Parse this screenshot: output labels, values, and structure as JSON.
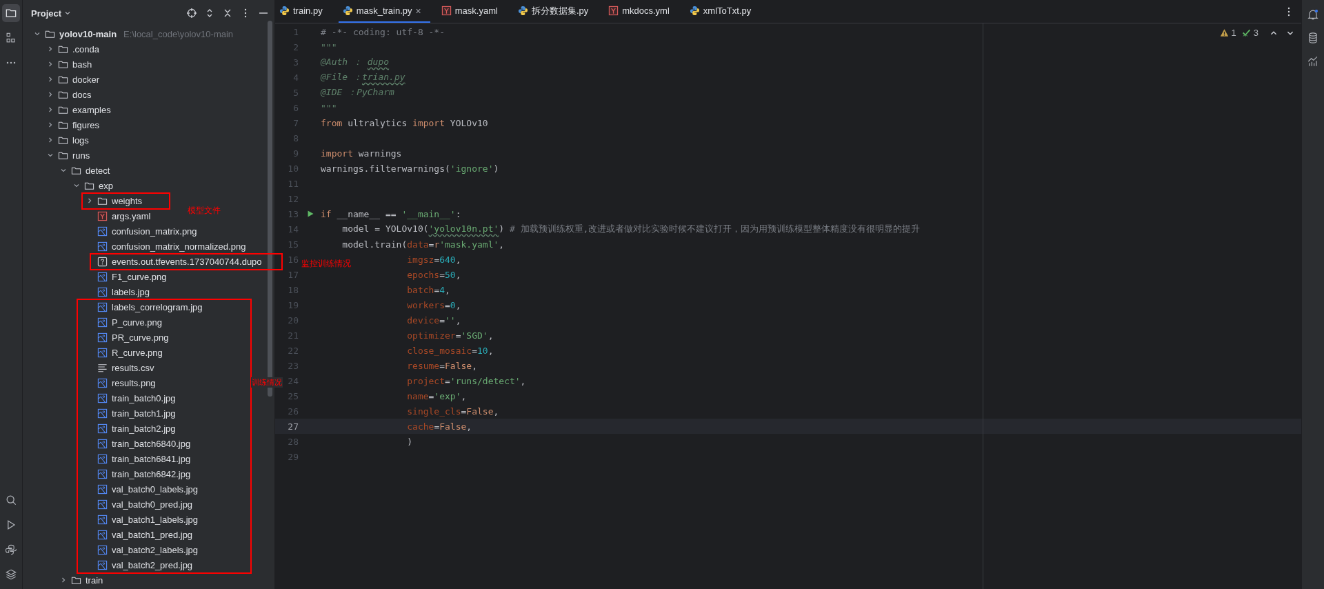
{
  "project_panel": {
    "title": "Project",
    "tree": [
      {
        "name": "yolov10-main",
        "path": "E:\\local_code\\yolov10-main",
        "kind": "folder",
        "expanded": true,
        "children": [
          {
            "name": ".conda",
            "kind": "folder",
            "expanded": false
          },
          {
            "name": "bash",
            "kind": "folder",
            "expanded": false
          },
          {
            "name": "docker",
            "kind": "folder",
            "expanded": false
          },
          {
            "name": "docs",
            "kind": "folder",
            "expanded": false
          },
          {
            "name": "examples",
            "kind": "folder",
            "expanded": false
          },
          {
            "name": "figures",
            "kind": "folder",
            "expanded": false
          },
          {
            "name": "logs",
            "kind": "folder",
            "expanded": false
          },
          {
            "name": "runs",
            "kind": "folder",
            "expanded": true,
            "children": [
              {
                "name": "detect",
                "kind": "folder",
                "expanded": true,
                "children": [
                  {
                    "name": "exp",
                    "kind": "folder",
                    "expanded": true,
                    "children": [
                      {
                        "name": "weights",
                        "kind": "folder",
                        "expanded": false
                      },
                      {
                        "name": "args.yaml",
                        "kind": "yaml"
                      },
                      {
                        "name": "confusion_matrix.png",
                        "kind": "image"
                      },
                      {
                        "name": "confusion_matrix_normalized.png",
                        "kind": "image"
                      },
                      {
                        "name": "events.out.tfevents.1737040744.dupo",
                        "kind": "unknown"
                      },
                      {
                        "name": "F1_curve.png",
                        "kind": "image"
                      },
                      {
                        "name": "labels.jpg",
                        "kind": "image"
                      },
                      {
                        "name": "labels_correlogram.jpg",
                        "kind": "image"
                      },
                      {
                        "name": "P_curve.png",
                        "kind": "image"
                      },
                      {
                        "name": "PR_curve.png",
                        "kind": "image"
                      },
                      {
                        "name": "R_curve.png",
                        "kind": "image"
                      },
                      {
                        "name": "results.csv",
                        "kind": "text"
                      },
                      {
                        "name": "results.png",
                        "kind": "image"
                      },
                      {
                        "name": "train_batch0.jpg",
                        "kind": "image"
                      },
                      {
                        "name": "train_batch1.jpg",
                        "kind": "image"
                      },
                      {
                        "name": "train_batch2.jpg",
                        "kind": "image"
                      },
                      {
                        "name": "train_batch6840.jpg",
                        "kind": "image"
                      },
                      {
                        "name": "train_batch6841.jpg",
                        "kind": "image"
                      },
                      {
                        "name": "train_batch6842.jpg",
                        "kind": "image"
                      },
                      {
                        "name": "val_batch0_labels.jpg",
                        "kind": "image"
                      },
                      {
                        "name": "val_batch0_pred.jpg",
                        "kind": "image"
                      },
                      {
                        "name": "val_batch1_labels.jpg",
                        "kind": "image"
                      },
                      {
                        "name": "val_batch1_pred.jpg",
                        "kind": "image"
                      },
                      {
                        "name": "val_batch2_labels.jpg",
                        "kind": "image"
                      },
                      {
                        "name": "val_batch2_pred.jpg",
                        "kind": "image"
                      }
                    ]
                  }
                ]
              },
              {
                "name": "train",
                "kind": "folder",
                "expanded": false
              }
            ]
          }
        ]
      }
    ]
  },
  "tabs": [
    {
      "label": "train.py",
      "kind": "python",
      "selected": false
    },
    {
      "label": "mask_train.py",
      "kind": "python",
      "selected": true,
      "close": "×"
    },
    {
      "label": "mask.yaml",
      "kind": "yaml",
      "selected": false
    },
    {
      "label": "拆分数据集.py",
      "kind": "python",
      "selected": false
    },
    {
      "label": "mkdocs.yml",
      "kind": "yaml",
      "selected": false
    },
    {
      "label": "xmlToTxt.py",
      "kind": "python",
      "selected": false
    }
  ],
  "inspections": {
    "warnings": "1",
    "typos": "3"
  },
  "code": [
    {
      "number": "1",
      "tokens": [
        {
          "kind": "comment",
          "text": "# -*- coding: utf-8 -*-"
        }
      ]
    },
    {
      "number": "2",
      "tokens": [
        {
          "kind": "doc",
          "text": "\"\"\""
        }
      ]
    },
    {
      "number": "3",
      "tokens": [
        {
          "kind": "doc",
          "text": "@Auth ： "
        },
        {
          "kind": "doc",
          "text": "dupo",
          "typo": true
        }
      ]
    },
    {
      "number": "4",
      "tokens": [
        {
          "kind": "doc",
          "text": "@File ："
        },
        {
          "kind": "doc",
          "text": "trian.py",
          "typo": true
        }
      ]
    },
    {
      "number": "5",
      "tokens": [
        {
          "kind": "doc",
          "text": "@IDE ：PyCharm"
        }
      ]
    },
    {
      "number": "6",
      "tokens": [
        {
          "kind": "doc",
          "text": "\"\"\""
        }
      ]
    },
    {
      "number": "7",
      "tokens": [
        {
          "kind": "kw",
          "text": "from"
        },
        {
          "kind": "plain",
          "text": " ultralytics "
        },
        {
          "kind": "kw",
          "text": "import"
        },
        {
          "kind": "plain",
          "text": " YOLOv10"
        }
      ]
    },
    {
      "number": "8"
    },
    {
      "number": "9",
      "tokens": [
        {
          "kind": "kw",
          "text": "import"
        },
        {
          "kind": "plain",
          "text": " warnings"
        }
      ]
    },
    {
      "number": "10",
      "tokens": [
        {
          "kind": "plain",
          "text": "warnings.filterwarnings("
        },
        {
          "kind": "str",
          "text": "'ignore'"
        },
        {
          "kind": "plain",
          "text": ")"
        }
      ]
    },
    {
      "number": "11"
    },
    {
      "number": "12"
    },
    {
      "number": "13",
      "run": true,
      "tokens": [
        {
          "kind": "kw",
          "text": "if"
        },
        {
          "kind": "plain",
          "text": " __name__ == "
        },
        {
          "kind": "str",
          "text": "'__main__'"
        },
        {
          "kind": "plain",
          "text": ":"
        }
      ]
    },
    {
      "number": "14",
      "tokens": [
        {
          "kind": "plain",
          "text": "    model = YOLOv10("
        },
        {
          "kind": "str",
          "text": "'yolov10n.pt'",
          "typo": true
        },
        {
          "kind": "plain",
          "text": ")"
        },
        {
          "kind": "comment",
          "text": " # 加载预训练权重,改进或者做对比实验时候不建议打开，因为用预训练模型整体精度没有很明显的提升"
        }
      ]
    },
    {
      "number": "15",
      "tokens": [
        {
          "kind": "plain",
          "text": "    model.train("
        },
        {
          "kind": "param",
          "text": "data"
        },
        {
          "kind": "plain",
          "text": "="
        },
        {
          "kind": "kw",
          "text": "r"
        },
        {
          "kind": "str",
          "text": "'mask.yaml'"
        },
        {
          "kind": "plain",
          "text": ","
        }
      ]
    },
    {
      "number": "16",
      "tokens": [
        {
          "kind": "param",
          "text": "                imgsz"
        },
        {
          "kind": "plain",
          "text": "="
        },
        {
          "kind": "num",
          "text": "640"
        },
        {
          "kind": "plain",
          "text": ","
        }
      ]
    },
    {
      "number": "17",
      "tokens": [
        {
          "kind": "param",
          "text": "                epochs"
        },
        {
          "kind": "plain",
          "text": "="
        },
        {
          "kind": "num",
          "text": "50"
        },
        {
          "kind": "plain",
          "text": ","
        }
      ]
    },
    {
      "number": "18",
      "tokens": [
        {
          "kind": "param",
          "text": "                batch"
        },
        {
          "kind": "plain",
          "text": "="
        },
        {
          "kind": "num",
          "text": "4"
        },
        {
          "kind": "plain",
          "text": ","
        }
      ]
    },
    {
      "number": "19",
      "tokens": [
        {
          "kind": "param",
          "text": "                workers"
        },
        {
          "kind": "plain",
          "text": "="
        },
        {
          "kind": "num",
          "text": "0"
        },
        {
          "kind": "plain",
          "text": ","
        }
      ]
    },
    {
      "number": "20",
      "tokens": [
        {
          "kind": "param",
          "text": "                device"
        },
        {
          "kind": "plain",
          "text": "="
        },
        {
          "kind": "str",
          "text": "''"
        },
        {
          "kind": "plain",
          "text": ","
        }
      ]
    },
    {
      "number": "21",
      "tokens": [
        {
          "kind": "param",
          "text": "                optimizer"
        },
        {
          "kind": "plain",
          "text": "="
        },
        {
          "kind": "str",
          "text": "'SGD'"
        },
        {
          "kind": "plain",
          "text": ","
        }
      ]
    },
    {
      "number": "22",
      "tokens": [
        {
          "kind": "param",
          "text": "                close_mosaic"
        },
        {
          "kind": "plain",
          "text": "="
        },
        {
          "kind": "num",
          "text": "10"
        },
        {
          "kind": "plain",
          "text": ","
        }
      ]
    },
    {
      "number": "23",
      "tokens": [
        {
          "kind": "param",
          "text": "                resume"
        },
        {
          "kind": "plain",
          "text": "="
        },
        {
          "kind": "kw",
          "text": "False"
        },
        {
          "kind": "plain",
          "text": ","
        }
      ]
    },
    {
      "number": "24",
      "tokens": [
        {
          "kind": "param",
          "text": "                project"
        },
        {
          "kind": "plain",
          "text": "="
        },
        {
          "kind": "str",
          "text": "'runs/detect'"
        },
        {
          "kind": "plain",
          "text": ","
        }
      ]
    },
    {
      "number": "25",
      "tokens": [
        {
          "kind": "param",
          "text": "                name"
        },
        {
          "kind": "plain",
          "text": "="
        },
        {
          "kind": "str",
          "text": "'exp'"
        },
        {
          "kind": "plain",
          "text": ","
        }
      ]
    },
    {
      "number": "26",
      "tokens": [
        {
          "kind": "param",
          "text": "                single_cls"
        },
        {
          "kind": "plain",
          "text": "="
        },
        {
          "kind": "kw",
          "text": "False"
        },
        {
          "kind": "plain",
          "text": ","
        }
      ]
    },
    {
      "number": "27",
      "current": true,
      "tokens": [
        {
          "kind": "param",
          "text": "                cache"
        },
        {
          "kind": "plain",
          "text": "="
        },
        {
          "kind": "kw",
          "text": "False"
        },
        {
          "kind": "plain",
          "text": ","
        }
      ]
    },
    {
      "number": "28",
      "tokens": [
        {
          "kind": "plain",
          "text": "                )"
        }
      ]
    },
    {
      "number": "29"
    }
  ],
  "annotations": [
    {
      "label": "模型文件"
    },
    {
      "label": "监控训练情况"
    },
    {
      "label": "训练情况"
    }
  ]
}
